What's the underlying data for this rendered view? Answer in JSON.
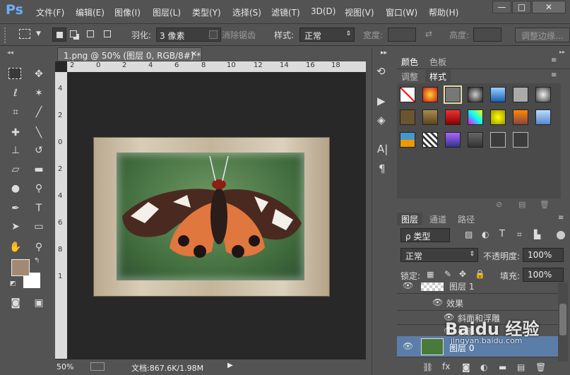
{
  "app": {
    "logo": "Ps"
  },
  "menu": [
    "文件(F)",
    "编辑(E)",
    "图像(I)",
    "图层(L)",
    "类型(Y)",
    "选择(S)",
    "滤镜(T)",
    "3D(D)",
    "视图(V)",
    "窗口(W)",
    "帮助(H)"
  ],
  "window_controls": {
    "minimize": "—",
    "maximize": "□",
    "close": "✕"
  },
  "options": {
    "feather_label": "羽化:",
    "feather_value": "3 像素",
    "antialias_label": "消除锯齿",
    "style_label": "样式:",
    "style_value": "正常",
    "width_label": "宽度:",
    "height_label": "高度:",
    "refine_edge": "调整边缘..."
  },
  "document": {
    "tab_title": "1.png @ 50% (图层 0, RGB/8#) *",
    "close": "✕",
    "ruler_h": [
      "2",
      "0",
      "2",
      "4",
      "6",
      "8",
      "10",
      "12",
      "14",
      "16",
      "18"
    ],
    "ruler_v": [
      "4",
      "2",
      "0",
      "2",
      "4",
      "6",
      "8",
      "1"
    ],
    "zoom": "50%",
    "doc_info": "文档:867.6K/1.98M"
  },
  "colors": {
    "bg": "#535353",
    "canvas_bg": "#282828",
    "accent_layer": "#5b7ea8",
    "foreground": "#a08a73",
    "background": "#ffffff"
  },
  "color_panel": {
    "tabs": [
      "颜色",
      "色板"
    ],
    "tabs2": [
      "调整",
      "样式"
    ]
  },
  "layers_panel": {
    "tabs": [
      "图层",
      "通道",
      "路径"
    ],
    "filter_label": "ρ 类型",
    "blend_mode": "正常",
    "opacity_label": "不透明度:",
    "opacity_value": "100%",
    "lock_label": "锁定:",
    "fill_label": "填充:",
    "fill_value": "100%",
    "layers": [
      {
        "name": "图层 1"
      },
      {
        "name": "效果"
      },
      {
        "name": "斜面和浮雕"
      },
      {
        "name": "投影"
      },
      {
        "name": "图层 0"
      }
    ]
  },
  "watermark": {
    "text": "Baidu 经验",
    "url": "jingyan.baidu.com"
  }
}
